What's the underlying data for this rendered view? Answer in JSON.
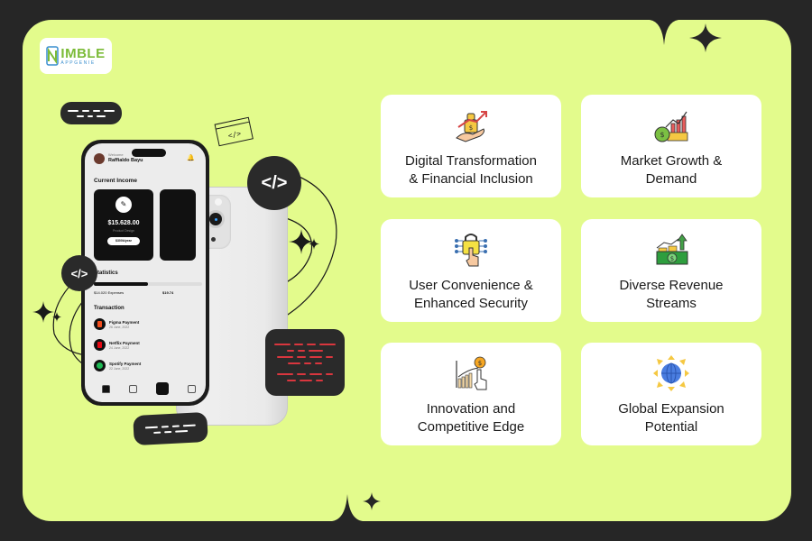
{
  "brand": {
    "logo_main": "IMBLE",
    "logo_sub": "APPGENIE",
    "logo_initial": "N"
  },
  "colors": {
    "background": "#262626",
    "panel": "#e3fb8c",
    "card": "#ffffff",
    "badge": "#2a2a2a",
    "code_red": "#d9363e",
    "logo_green": "#7bbb37",
    "logo_blue": "#3a8fcf"
  },
  "decorations": {
    "code_symbol": "</>",
    "sparkle": "✦"
  },
  "phone_app": {
    "welcome": "Welcome",
    "username": "Raffialdo Bayu",
    "current_income_title": "Current Income",
    "income_amount": "$15.628.00",
    "income_category": "Product Design",
    "income_rate": "$300k/year",
    "statistics_title": "Statistics",
    "expenses": "$14.020 Expenses",
    "stat_right": "$19.74",
    "transaction_title": "Transaction",
    "transactions": [
      {
        "name": "Figma Payment",
        "date": "26 June, 2022",
        "color": "#f24e1e"
      },
      {
        "name": "Netflix Payment",
        "date": "24 June, 2022",
        "color": "#e50914"
      },
      {
        "name": "Spotify Payment",
        "date": "22 June, 2022",
        "color": "#1db954"
      }
    ]
  },
  "features": [
    {
      "label": "Digital Transformation\n& Financial Inclusion",
      "icon": "money-bag-hand-growth-icon"
    },
    {
      "label": "Market Growth &\nDemand",
      "icon": "money-bag-chart-growth-icon"
    },
    {
      "label": "User Convenience &\nEnhanced Security",
      "icon": "lock-touch-circuit-icon"
    },
    {
      "label": "Diverse Revenue\nStreams",
      "icon": "cash-coins-up-arrow-icon"
    },
    {
      "label": "Innovation and\nCompetitive Edge",
      "icon": "chart-dollar-tap-icon"
    },
    {
      "label": "Global Expansion\nPotential",
      "icon": "globe-arrows-icon"
    }
  ]
}
